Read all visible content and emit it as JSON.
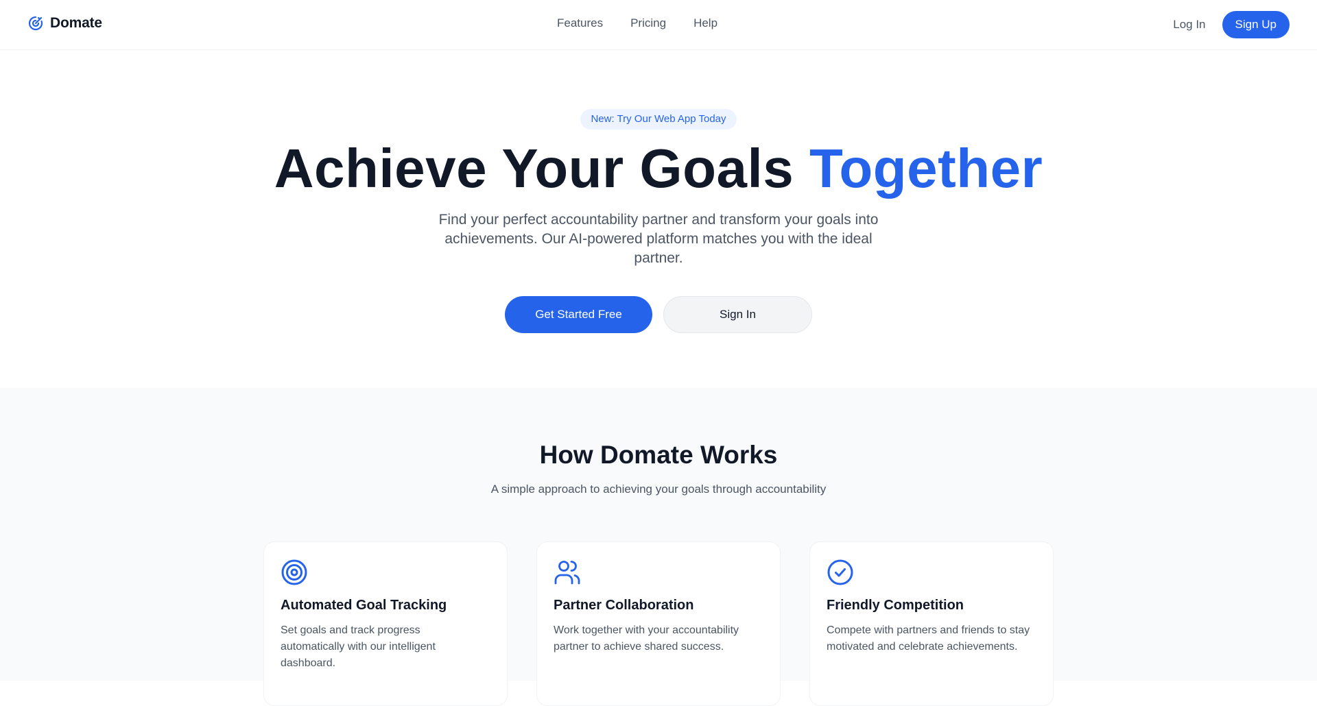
{
  "nav": {
    "brand": "Domate",
    "links": [
      "Features",
      "Pricing",
      "Help"
    ],
    "login": "Log In",
    "signup": "Sign Up"
  },
  "hero": {
    "badge": "New: Try Our Web App Today",
    "title_main": "Achieve Your Goals",
    "title_accent": "Together",
    "subtitle": "Find your perfect accountability partner and transform your goals into achievements. Our AI-powered platform matches you with the ideal partner.",
    "cta_primary": "Get Started Free",
    "cta_secondary": "Sign In"
  },
  "works": {
    "title": "How Domate Works",
    "subtitle": "A simple approach to achieving your goals through accountability",
    "cards": [
      {
        "icon": "target-icon",
        "title": "Automated Goal Tracking",
        "desc": "Set goals and track progress automatically with our intelligent dashboard."
      },
      {
        "icon": "users-icon",
        "title": "Partner Collaboration",
        "desc": "Work together with your accountability partner to achieve shared success."
      },
      {
        "icon": "check-circle-icon",
        "title": "Friendly Competition",
        "desc": "Compete with partners and friends to stay motivated and celebrate achievements."
      }
    ]
  },
  "colors": {
    "accent": "#2563eb",
    "text": "#111827",
    "muted": "#4b5563",
    "section_bg": "#f9fafb"
  }
}
